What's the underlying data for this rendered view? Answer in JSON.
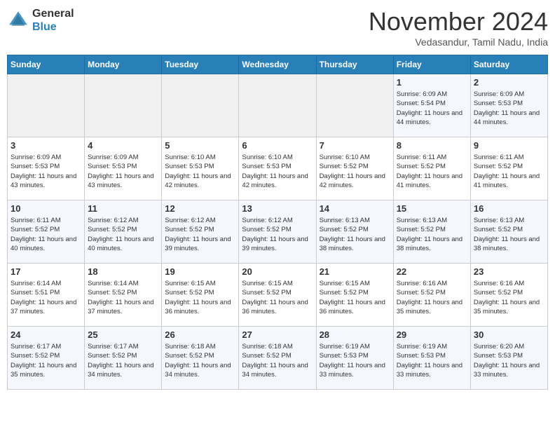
{
  "header": {
    "logo_line1": "General",
    "logo_line2": "Blue",
    "month_title": "November 2024",
    "location": "Vedasandur, Tamil Nadu, India"
  },
  "weekdays": [
    "Sunday",
    "Monday",
    "Tuesday",
    "Wednesday",
    "Thursday",
    "Friday",
    "Saturday"
  ],
  "weeks": [
    [
      {
        "day": "",
        "empty": true
      },
      {
        "day": "",
        "empty": true
      },
      {
        "day": "",
        "empty": true
      },
      {
        "day": "",
        "empty": true
      },
      {
        "day": "",
        "empty": true
      },
      {
        "day": "1",
        "sunrise": "6:09 AM",
        "sunset": "5:54 PM",
        "daylight": "11 hours and 44 minutes."
      },
      {
        "day": "2",
        "sunrise": "6:09 AM",
        "sunset": "5:53 PM",
        "daylight": "11 hours and 44 minutes."
      }
    ],
    [
      {
        "day": "3",
        "sunrise": "6:09 AM",
        "sunset": "5:53 PM",
        "daylight": "11 hours and 43 minutes."
      },
      {
        "day": "4",
        "sunrise": "6:09 AM",
        "sunset": "5:53 PM",
        "daylight": "11 hours and 43 minutes."
      },
      {
        "day": "5",
        "sunrise": "6:10 AM",
        "sunset": "5:53 PM",
        "daylight": "11 hours and 42 minutes."
      },
      {
        "day": "6",
        "sunrise": "6:10 AM",
        "sunset": "5:53 PM",
        "daylight": "11 hours and 42 minutes."
      },
      {
        "day": "7",
        "sunrise": "6:10 AM",
        "sunset": "5:52 PM",
        "daylight": "11 hours and 42 minutes."
      },
      {
        "day": "8",
        "sunrise": "6:11 AM",
        "sunset": "5:52 PM",
        "daylight": "11 hours and 41 minutes."
      },
      {
        "day": "9",
        "sunrise": "6:11 AM",
        "sunset": "5:52 PM",
        "daylight": "11 hours and 41 minutes."
      }
    ],
    [
      {
        "day": "10",
        "sunrise": "6:11 AM",
        "sunset": "5:52 PM",
        "daylight": "11 hours and 40 minutes."
      },
      {
        "day": "11",
        "sunrise": "6:12 AM",
        "sunset": "5:52 PM",
        "daylight": "11 hours and 40 minutes."
      },
      {
        "day": "12",
        "sunrise": "6:12 AM",
        "sunset": "5:52 PM",
        "daylight": "11 hours and 39 minutes."
      },
      {
        "day": "13",
        "sunrise": "6:12 AM",
        "sunset": "5:52 PM",
        "daylight": "11 hours and 39 minutes."
      },
      {
        "day": "14",
        "sunrise": "6:13 AM",
        "sunset": "5:52 PM",
        "daylight": "11 hours and 38 minutes."
      },
      {
        "day": "15",
        "sunrise": "6:13 AM",
        "sunset": "5:52 PM",
        "daylight": "11 hours and 38 minutes."
      },
      {
        "day": "16",
        "sunrise": "6:13 AM",
        "sunset": "5:52 PM",
        "daylight": "11 hours and 38 minutes."
      }
    ],
    [
      {
        "day": "17",
        "sunrise": "6:14 AM",
        "sunset": "5:51 PM",
        "daylight": "11 hours and 37 minutes."
      },
      {
        "day": "18",
        "sunrise": "6:14 AM",
        "sunset": "5:52 PM",
        "daylight": "11 hours and 37 minutes."
      },
      {
        "day": "19",
        "sunrise": "6:15 AM",
        "sunset": "5:52 PM",
        "daylight": "11 hours and 36 minutes."
      },
      {
        "day": "20",
        "sunrise": "6:15 AM",
        "sunset": "5:52 PM",
        "daylight": "11 hours and 36 minutes."
      },
      {
        "day": "21",
        "sunrise": "6:15 AM",
        "sunset": "5:52 PM",
        "daylight": "11 hours and 36 minutes."
      },
      {
        "day": "22",
        "sunrise": "6:16 AM",
        "sunset": "5:52 PM",
        "daylight": "11 hours and 35 minutes."
      },
      {
        "day": "23",
        "sunrise": "6:16 AM",
        "sunset": "5:52 PM",
        "daylight": "11 hours and 35 minutes."
      }
    ],
    [
      {
        "day": "24",
        "sunrise": "6:17 AM",
        "sunset": "5:52 PM",
        "daylight": "11 hours and 35 minutes."
      },
      {
        "day": "25",
        "sunrise": "6:17 AM",
        "sunset": "5:52 PM",
        "daylight": "11 hours and 34 minutes."
      },
      {
        "day": "26",
        "sunrise": "6:18 AM",
        "sunset": "5:52 PM",
        "daylight": "11 hours and 34 minutes."
      },
      {
        "day": "27",
        "sunrise": "6:18 AM",
        "sunset": "5:52 PM",
        "daylight": "11 hours and 34 minutes."
      },
      {
        "day": "28",
        "sunrise": "6:19 AM",
        "sunset": "5:53 PM",
        "daylight": "11 hours and 33 minutes."
      },
      {
        "day": "29",
        "sunrise": "6:19 AM",
        "sunset": "5:53 PM",
        "daylight": "11 hours and 33 minutes."
      },
      {
        "day": "30",
        "sunrise": "6:20 AM",
        "sunset": "5:53 PM",
        "daylight": "11 hours and 33 minutes."
      }
    ]
  ]
}
